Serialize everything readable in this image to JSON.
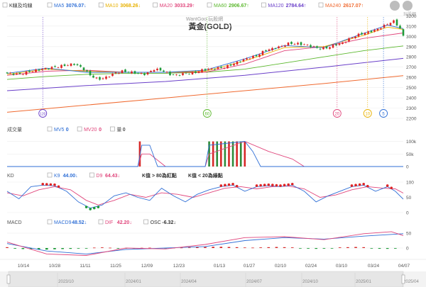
{
  "chart_data": {
    "type": "candlestick-with-indicators",
    "title": "黃金(GOLD)",
    "watermark": "WantGoo 玩股網",
    "logo_text": "玩股網",
    "price_panel": {
      "legend_label": "K線及均線",
      "ma_legend": [
        {
          "name": "MA5",
          "value": "3076.07",
          "arrow": "↓",
          "color": "#2f6fd6"
        },
        {
          "name": "MA10",
          "value": "3068.26",
          "arrow": "↓",
          "color": "#e8b100"
        },
        {
          "name": "MA20",
          "value": "3033.29",
          "arrow": "↑",
          "color": "#e0457b"
        },
        {
          "name": "MA60",
          "value": "2906.67",
          "arrow": "↑",
          "color": "#5cb82e"
        },
        {
          "name": "MA120",
          "value": "2784.64",
          "arrow": "↑",
          "color": "#6a3fc9"
        },
        {
          "name": "MA240",
          "value": "2617.07",
          "arrow": "↑",
          "color": "#f06a30"
        }
      ],
      "y_ticks": [
        3200,
        3100,
        3000,
        2900,
        2800,
        2700,
        2600,
        2500,
        2400,
        2300,
        2200
      ],
      "ylim": [
        2180,
        3230
      ],
      "bubbles": [
        {
          "label": "120",
          "color": "#6a3fc9",
          "x": 0.09
        },
        {
          "label": "60",
          "color": "#5cb82e",
          "x": 0.505
        },
        {
          "label": "20",
          "color": "#e0457b",
          "x": 0.833
        },
        {
          "label": "10",
          "color": "#e8b100",
          "x": 0.91
        },
        {
          "label": "5",
          "color": "#2f6fd6",
          "x": 0.95
        }
      ],
      "close_path": [
        [
          0.0,
          2640
        ],
        [
          0.03,
          2630
        ],
        [
          0.06,
          2660
        ],
        [
          0.09,
          2680
        ],
        [
          0.12,
          2700
        ],
        [
          0.15,
          2720
        ],
        [
          0.17,
          2730
        ],
        [
          0.19,
          2690
        ],
        [
          0.21,
          2620
        ],
        [
          0.23,
          2580
        ],
        [
          0.25,
          2600
        ],
        [
          0.27,
          2640
        ],
        [
          0.29,
          2660
        ],
        [
          0.31,
          2650
        ],
        [
          0.33,
          2640
        ],
        [
          0.35,
          2630
        ],
        [
          0.37,
          2680
        ],
        [
          0.39,
          2670
        ],
        [
          0.41,
          2630
        ],
        [
          0.43,
          2620
        ],
        [
          0.45,
          2640
        ],
        [
          0.47,
          2640
        ],
        [
          0.49,
          2670
        ],
        [
          0.51,
          2680
        ],
        [
          0.53,
          2690
        ],
        [
          0.55,
          2700
        ],
        [
          0.57,
          2730
        ],
        [
          0.59,
          2760
        ],
        [
          0.61,
          2790
        ],
        [
          0.63,
          2810
        ],
        [
          0.65,
          2860
        ],
        [
          0.67,
          2880
        ],
        [
          0.69,
          2900
        ],
        [
          0.71,
          2930
        ],
        [
          0.73,
          2930
        ],
        [
          0.75,
          2920
        ],
        [
          0.77,
          2900
        ],
        [
          0.79,
          2880
        ],
        [
          0.81,
          2890
        ],
        [
          0.83,
          2920
        ],
        [
          0.85,
          2940
        ],
        [
          0.87,
          2990
        ],
        [
          0.89,
          3020
        ],
        [
          0.91,
          3040
        ],
        [
          0.93,
          3060
        ],
        [
          0.95,
          3100
        ],
        [
          0.965,
          3130
        ],
        [
          0.975,
          3150
        ],
        [
          0.985,
          3110
        ],
        [
          0.995,
          3060
        ],
        [
          1.0,
          3000
        ]
      ],
      "ma_paths": {
        "MA5": [
          [
            0.0,
            2640
          ],
          [
            0.1,
            2690
          ],
          [
            0.2,
            2650
          ],
          [
            0.3,
            2650
          ],
          [
            0.4,
            2650
          ],
          [
            0.5,
            2670
          ],
          [
            0.6,
            2780
          ],
          [
            0.7,
            2910
          ],
          [
            0.8,
            2890
          ],
          [
            0.9,
            3030
          ],
          [
            0.96,
            3110
          ],
          [
            1.0,
            3076
          ]
        ],
        "MA10": [
          [
            0.0,
            2630
          ],
          [
            0.1,
            2680
          ],
          [
            0.2,
            2660
          ],
          [
            0.3,
            2650
          ],
          [
            0.4,
            2650
          ],
          [
            0.5,
            2660
          ],
          [
            0.6,
            2760
          ],
          [
            0.7,
            2890
          ],
          [
            0.8,
            2900
          ],
          [
            0.9,
            3010
          ],
          [
            0.96,
            3090
          ],
          [
            1.0,
            3068
          ]
        ],
        "MA20": [
          [
            0.0,
            2620
          ],
          [
            0.1,
            2660
          ],
          [
            0.2,
            2670
          ],
          [
            0.3,
            2650
          ],
          [
            0.4,
            2650
          ],
          [
            0.5,
            2650
          ],
          [
            0.6,
            2730
          ],
          [
            0.7,
            2860
          ],
          [
            0.8,
            2900
          ],
          [
            0.9,
            2980
          ],
          [
            1.0,
            3033
          ]
        ],
        "MA60": [
          [
            0.0,
            2580
          ],
          [
            0.1,
            2610
          ],
          [
            0.2,
            2630
          ],
          [
            0.3,
            2640
          ],
          [
            0.4,
            2640
          ],
          [
            0.5,
            2650
          ],
          [
            0.6,
            2680
          ],
          [
            0.7,
            2740
          ],
          [
            0.8,
            2800
          ],
          [
            0.9,
            2860
          ],
          [
            1.0,
            2907
          ]
        ],
        "MA120": [
          [
            0.0,
            2470
          ],
          [
            0.2,
            2520
          ],
          [
            0.4,
            2560
          ],
          [
            0.6,
            2620
          ],
          [
            0.8,
            2700
          ],
          [
            1.0,
            2785
          ]
        ],
        "MA240": [
          [
            0.0,
            2260
          ],
          [
            0.2,
            2330
          ],
          [
            0.4,
            2400
          ],
          [
            0.6,
            2470
          ],
          [
            0.8,
            2540
          ],
          [
            1.0,
            2617
          ]
        ]
      }
    },
    "volume_panel": {
      "label": "成交量",
      "legend": [
        {
          "name": "MV5",
          "value": "0",
          "color": "#2f6fd6"
        },
        {
          "name": "MV20",
          "value": "0",
          "color": "#e0457b"
        },
        {
          "name": "量",
          "value": "0",
          "color": "#555555"
        }
      ],
      "y_ticks": [
        "100k",
        "50k",
        "0"
      ],
      "bars": [
        [
          0.335,
          100
        ],
        [
          0.51,
          100
        ],
        [
          0.52,
          100
        ],
        [
          0.53,
          100
        ],
        [
          0.54,
          100
        ],
        [
          0.55,
          100
        ],
        [
          0.56,
          100
        ],
        [
          0.57,
          100
        ],
        [
          0.58,
          100
        ],
        [
          0.59,
          100
        ],
        [
          0.6,
          100
        ]
      ],
      "mv5_path": [
        [
          0.0,
          0
        ],
        [
          0.33,
          0
        ],
        [
          0.34,
          85
        ],
        [
          0.36,
          85
        ],
        [
          0.38,
          0
        ],
        [
          0.5,
          0
        ],
        [
          0.51,
          85
        ],
        [
          0.6,
          100
        ],
        [
          0.62,
          60
        ],
        [
          0.64,
          0
        ],
        [
          1.0,
          0
        ]
      ],
      "mv20_path": [
        [
          0.0,
          0
        ],
        [
          0.33,
          0
        ],
        [
          0.34,
          50
        ],
        [
          0.36,
          50
        ],
        [
          0.4,
          0
        ],
        [
          0.5,
          0
        ],
        [
          0.51,
          50
        ],
        [
          0.6,
          100
        ],
        [
          0.66,
          60
        ],
        [
          0.72,
          30
        ],
        [
          0.75,
          0
        ],
        [
          1.0,
          0
        ]
      ]
    },
    "kd_panel": {
      "label": "KD",
      "legend": [
        {
          "name": "K9",
          "value": "44.00",
          "arrow": "↓",
          "color": "#2f6fd6"
        },
        {
          "name": "D9",
          "value": "64.43",
          "arrow": "↓",
          "color": "#e0457b"
        }
      ],
      "notes": [
        "K值 > 80為紅點",
        "K值 < 20為綠點"
      ],
      "y_ticks": [
        100,
        50,
        0
      ],
      "k_path": [
        [
          0.0,
          70
        ],
        [
          0.03,
          45
        ],
        [
          0.06,
          85
        ],
        [
          0.09,
          90
        ],
        [
          0.12,
          88
        ],
        [
          0.15,
          70
        ],
        [
          0.18,
          35
        ],
        [
          0.21,
          15
        ],
        [
          0.24,
          25
        ],
        [
          0.27,
          55
        ],
        [
          0.3,
          65
        ],
        [
          0.33,
          50
        ],
        [
          0.36,
          40
        ],
        [
          0.39,
          80
        ],
        [
          0.42,
          55
        ],
        [
          0.45,
          35
        ],
        [
          0.48,
          60
        ],
        [
          0.51,
          75
        ],
        [
          0.54,
          85
        ],
        [
          0.57,
          90
        ],
        [
          0.6,
          70
        ],
        [
          0.63,
          85
        ],
        [
          0.66,
          88
        ],
        [
          0.69,
          85
        ],
        [
          0.72,
          90
        ],
        [
          0.75,
          70
        ],
        [
          0.78,
          35
        ],
        [
          0.81,
          55
        ],
        [
          0.84,
          70
        ],
        [
          0.87,
          85
        ],
        [
          0.9,
          90
        ],
        [
          0.93,
          70
        ],
        [
          0.96,
          85
        ],
        [
          0.98,
          70
        ],
        [
          1.0,
          44
        ]
      ],
      "d_path": [
        [
          0.0,
          65
        ],
        [
          0.04,
          55
        ],
        [
          0.08,
          75
        ],
        [
          0.12,
          85
        ],
        [
          0.16,
          75
        ],
        [
          0.2,
          40
        ],
        [
          0.23,
          25
        ],
        [
          0.27,
          40
        ],
        [
          0.31,
          60
        ],
        [
          0.35,
          50
        ],
        [
          0.39,
          65
        ],
        [
          0.43,
          60
        ],
        [
          0.47,
          50
        ],
        [
          0.51,
          65
        ],
        [
          0.55,
          80
        ],
        [
          0.59,
          85
        ],
        [
          0.63,
          78
        ],
        [
          0.67,
          85
        ],
        [
          0.71,
          87
        ],
        [
          0.75,
          78
        ],
        [
          0.79,
          50
        ],
        [
          0.83,
          58
        ],
        [
          0.87,
          75
        ],
        [
          0.91,
          85
        ],
        [
          0.95,
          80
        ],
        [
          0.98,
          78
        ],
        [
          1.0,
          64
        ]
      ],
      "red_dot_x": [
        0.09,
        0.1,
        0.11,
        0.12,
        0.13,
        0.54,
        0.55,
        0.56,
        0.57,
        0.58,
        0.63,
        0.64,
        0.65,
        0.66,
        0.67,
        0.68,
        0.69,
        0.7,
        0.71,
        0.72,
        0.87,
        0.88,
        0.89,
        0.9,
        0.91,
        0.96,
        0.97
      ],
      "green_dot_x": [
        0.2,
        0.21,
        0.22,
        0.23
      ]
    },
    "macd_panel": {
      "label": "MACD",
      "legend": [
        {
          "name": "MACD9",
          "value": "48.52",
          "arrow": "↓",
          "color": "#2f6fd6"
        },
        {
          "name": "DIF",
          "value": "42.20",
          "arrow": "↓",
          "color": "#e0457b"
        },
        {
          "name": "OSC",
          "value": "-6.32",
          "arrow": "↓",
          "color": "#333333"
        }
      ],
      "y_ticks": [
        50,
        0
      ],
      "osc_bars_x": [
        0.0,
        0.02,
        0.04,
        0.06,
        0.08,
        0.1,
        0.12,
        0.14,
        0.16,
        0.18,
        0.2,
        0.22,
        0.24,
        0.26,
        0.28,
        0.3,
        0.32,
        0.34,
        0.36,
        0.38,
        0.4,
        0.42,
        0.44,
        0.46,
        0.48,
        0.5,
        0.52,
        0.54,
        0.56,
        0.58,
        0.6,
        0.62,
        0.64,
        0.66,
        0.68,
        0.7,
        0.72,
        0.74,
        0.76,
        0.78,
        0.8,
        0.82,
        0.84,
        0.86,
        0.88,
        0.9,
        0.92,
        0.94,
        0.96,
        0.98
      ],
      "osc_bars_v": [
        8,
        -6,
        -10,
        -12,
        -14,
        -15,
        -12,
        -10,
        -8,
        -4,
        -2,
        4,
        6,
        3,
        -2,
        -4,
        -3,
        2,
        3,
        -2,
        -3,
        2,
        4,
        6,
        8,
        10,
        12,
        12,
        10,
        8,
        5,
        4,
        6,
        8,
        10,
        8,
        6,
        -4,
        -6,
        -8,
        -6,
        -4,
        6,
        8,
        10,
        8,
        -5,
        -7,
        -8,
        -6
      ],
      "macd_path": [
        [
          0.0,
          15
        ],
        [
          0.1,
          -10
        ],
        [
          0.2,
          -20
        ],
        [
          0.3,
          -5
        ],
        [
          0.4,
          0
        ],
        [
          0.5,
          5
        ],
        [
          0.6,
          25
        ],
        [
          0.7,
          35
        ],
        [
          0.8,
          30
        ],
        [
          0.9,
          40
        ],
        [
          1.0,
          48
        ]
      ],
      "dif_path": [
        [
          0.0,
          20
        ],
        [
          0.1,
          -20
        ],
        [
          0.2,
          -25
        ],
        [
          0.3,
          0
        ],
        [
          0.4,
          -3
        ],
        [
          0.5,
          12
        ],
        [
          0.6,
          35
        ],
        [
          0.7,
          38
        ],
        [
          0.8,
          28
        ],
        [
          0.9,
          48
        ],
        [
          0.97,
          55
        ],
        [
          1.0,
          42
        ]
      ]
    },
    "x_ticks": [
      "10/14",
      "10/28",
      "11/11",
      "11/25",
      "12/09",
      "12/23",
      "01/13",
      "01/27",
      "02/10",
      "02/24",
      "03/10",
      "03/24",
      "04/07"
    ],
    "navigator_ticks": [
      "2023/10",
      "2024/01",
      "2024/04",
      "2024/07",
      "2024/10",
      "2025/01",
      "2025/04"
    ]
  }
}
